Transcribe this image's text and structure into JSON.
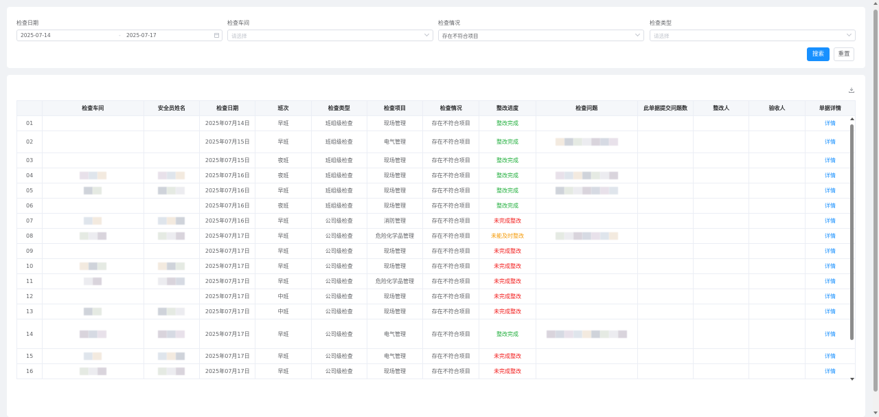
{
  "filters": {
    "date": {
      "label": "检查日期",
      "start": "2025-07-14",
      "separator": "-",
      "end": "2025-07-17"
    },
    "workshop": {
      "label": "检查车间",
      "placeholder": "请选择"
    },
    "status": {
      "label": "检查情况",
      "value": "存在不符合项目"
    },
    "type": {
      "label": "检查类型",
      "placeholder": "请选择"
    }
  },
  "buttons": {
    "search": "搜索",
    "reset": "重置"
  },
  "table": {
    "headers": [
      "检查车间",
      "安全员姓名",
      "检查日期",
      "班次",
      "检查类型",
      "检查项目",
      "检查情况",
      "整改进度",
      "检查问题",
      "此单据提交问题数",
      "整改人",
      "验收人",
      "单据详情"
    ],
    "rows": [
      {
        "no": "01",
        "date": "2025年07月14日",
        "shift": "早班",
        "type": "班组级检查",
        "item": "现场管理",
        "status": "存在不符合项目",
        "progress": "整改完成",
        "ptype": "done",
        "detail": "详情"
      },
      {
        "no": "02",
        "date": "2025年07月15日",
        "shift": "早班",
        "type": "班组级检查",
        "item": "电气管理",
        "status": "存在不符合项目",
        "progress": "整改完成",
        "ptype": "done",
        "detail": "详情"
      },
      {
        "no": "03",
        "date": "2025年07月15日",
        "shift": "夜班",
        "type": "班组级检查",
        "item": "现场管理",
        "status": "存在不符合项目",
        "progress": "整改完成",
        "ptype": "done",
        "detail": "详情"
      },
      {
        "no": "04",
        "date": "2025年07月16日",
        "shift": "夜班",
        "type": "班组级检查",
        "item": "现场管理",
        "status": "存在不符合项目",
        "progress": "整改完成",
        "ptype": "done",
        "detail": "详情"
      },
      {
        "no": "05",
        "date": "2025年07月16日",
        "shift": "早班",
        "type": "班组级检查",
        "item": "现场管理",
        "status": "存在不符合项目",
        "progress": "整改完成",
        "ptype": "done",
        "detail": "详情"
      },
      {
        "no": "06",
        "date": "2025年07月16日",
        "shift": "夜班",
        "type": "班组级检查",
        "item": "现场管理",
        "status": "存在不符合项目",
        "progress": "整改完成",
        "ptype": "done",
        "detail": "详情"
      },
      {
        "no": "07",
        "date": "2025年07月16日",
        "shift": "早班",
        "type": "公司级检查",
        "item": "消防管理",
        "status": "存在不符合项目",
        "progress": "未完成整改",
        "ptype": "undone",
        "detail": "详情"
      },
      {
        "no": "08",
        "date": "2025年07月17日",
        "shift": "早班",
        "type": "公司级检查",
        "item": "危险化学品管理",
        "status": "存在不符合项目",
        "progress": "未能及时整改",
        "ptype": "late",
        "detail": "详情"
      },
      {
        "no": "09",
        "date": "2025年07月17日",
        "shift": "早班",
        "type": "公司级检查",
        "item": "现场管理",
        "status": "存在不符合项目",
        "progress": "未完成整改",
        "ptype": "undone",
        "detail": "详情"
      },
      {
        "no": "10",
        "date": "2025年07月17日",
        "shift": "早班",
        "type": "公司级检查",
        "item": "现场管理",
        "status": "存在不符合项目",
        "progress": "未完成整改",
        "ptype": "undone",
        "detail": "详情"
      },
      {
        "no": "11",
        "date": "2025年07月17日",
        "shift": "早班",
        "type": "公司级检查",
        "item": "危险化学品管理",
        "status": "存在不符合项目",
        "progress": "未完成整改",
        "ptype": "undone",
        "detail": "详情"
      },
      {
        "no": "12",
        "date": "2025年07月17日",
        "shift": "中班",
        "type": "公司级检查",
        "item": "现场管理",
        "status": "存在不符合项目",
        "progress": "未完成整改",
        "ptype": "undone",
        "detail": "详情"
      },
      {
        "no": "13",
        "date": "2025年07月17日",
        "shift": "中班",
        "type": "公司级检查",
        "item": "现场管理",
        "status": "存在不符合项目",
        "progress": "未完成整改",
        "ptype": "undone",
        "detail": "详情"
      },
      {
        "no": "14",
        "date": "2025年07月17日",
        "shift": "早班",
        "type": "公司级检查",
        "item": "电气管理",
        "status": "存在不符合项目",
        "progress": "整改完成",
        "ptype": "done",
        "detail": "详情"
      },
      {
        "no": "15",
        "date": "2025年07月17日",
        "shift": "早班",
        "type": "公司级检查",
        "item": "电气管理",
        "status": "存在不符合项目",
        "progress": "未完成整改",
        "ptype": "undone",
        "detail": "详情"
      },
      {
        "no": "16",
        "date": "2025年07月17日",
        "shift": "早班",
        "type": "公司级检查",
        "item": "现场管理",
        "status": "存在不符合项目",
        "progress": "未完成整改",
        "ptype": "undone",
        "detail": "详情"
      }
    ]
  },
  "colors": {
    "primary": "#1890ff",
    "done": "#1fae3b",
    "undone": "#f21a1a",
    "late": "#f59a06"
  },
  "icons": {
    "download": "download-icon",
    "calendar": "calendar-icon",
    "dropdown": "chevron-down-icon"
  }
}
